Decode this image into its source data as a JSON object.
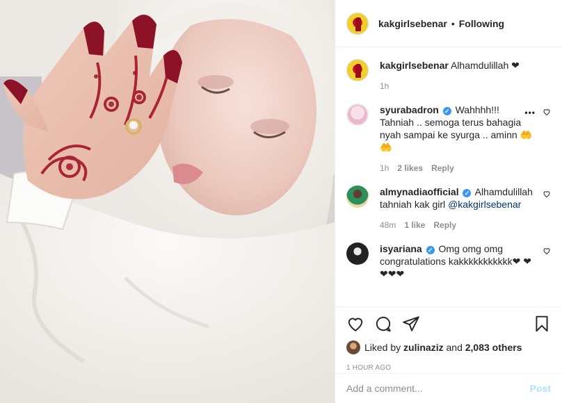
{
  "post": {
    "author": "kakgirlsebenar",
    "follow_status": "Following",
    "separator": "•"
  },
  "caption": {
    "username": "kakgirlsebenar",
    "text": "Alhamdulillah ❤",
    "time": "1h"
  },
  "comments": [
    {
      "username": "syurabadron",
      "verified": true,
      "text": "Wahhhh!!! Tahniah .. semoga terus bahagia nyah sampai ke syurga .. aminn 🤲🤲",
      "time": "1h",
      "likes": "2 likes",
      "reply": "Reply",
      "more": "•••"
    },
    {
      "username": "almynadiaofficial",
      "verified": true,
      "text": "Alhamdulillah tahniah kak girl",
      "mention": "@kakgirlsebenar",
      "time": "48m",
      "likes": "1 like",
      "reply": "Reply"
    },
    {
      "username": "isyariana",
      "verified": true,
      "text": "Omg omg omg congratulations kakkkkkkkkkkk❤ ❤❤❤❤",
      "time": "",
      "likes": "",
      "reply": ""
    }
  ],
  "likes": {
    "prefix": "Liked by",
    "user": "zulinaziz",
    "and": "and",
    "others": "2,083 others"
  },
  "timestamp": "1 HOUR AGO",
  "comment_box": {
    "placeholder": "Add a comment...",
    "post_label": "Post"
  },
  "colors": {
    "link": "#00376b",
    "verified": "#3897f0",
    "muted": "#8e8e8e",
    "post_disabled": "#b2dffc",
    "henna": "#a3152a"
  },
  "icons": {
    "like": "heart-icon",
    "comment": "comment-icon",
    "share": "share-icon",
    "save": "bookmark-icon"
  }
}
